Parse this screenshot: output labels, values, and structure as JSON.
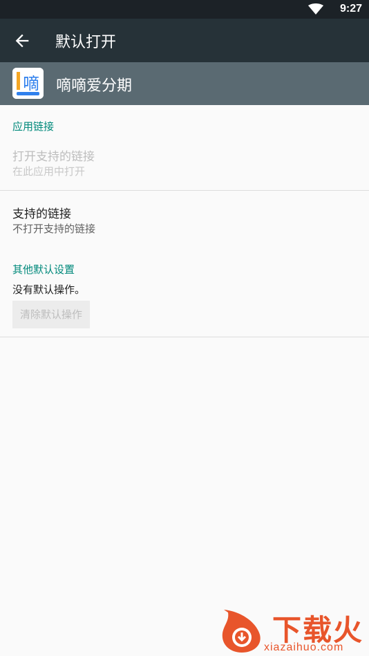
{
  "status_bar": {
    "time": "9:27",
    "wifi_icon": "wifi-icon"
  },
  "toolbar": {
    "back_icon": "arrow-left-icon",
    "title": "默认打开"
  },
  "app": {
    "name": "嘀嘀爱分期",
    "icon_char": "嘀"
  },
  "sections": {
    "app_links": {
      "header": "应用链接",
      "open_supported": {
        "title": "打开支持的链接",
        "subtitle": "在此应用中打开"
      },
      "supported_links": {
        "title": "支持的链接",
        "subtitle": "不打开支持的链接"
      }
    },
    "other_defaults": {
      "header": "其他默认设置",
      "status": "没有默认操作。",
      "clear_button": "清除默认操作"
    }
  },
  "watermark": {
    "brand": "下载火",
    "url": "xiazaihuo.com"
  },
  "colors": {
    "toolbar": "#263238",
    "app_header": "#5a6a72",
    "accent": "#00897b",
    "watermark": "#e8552b"
  }
}
